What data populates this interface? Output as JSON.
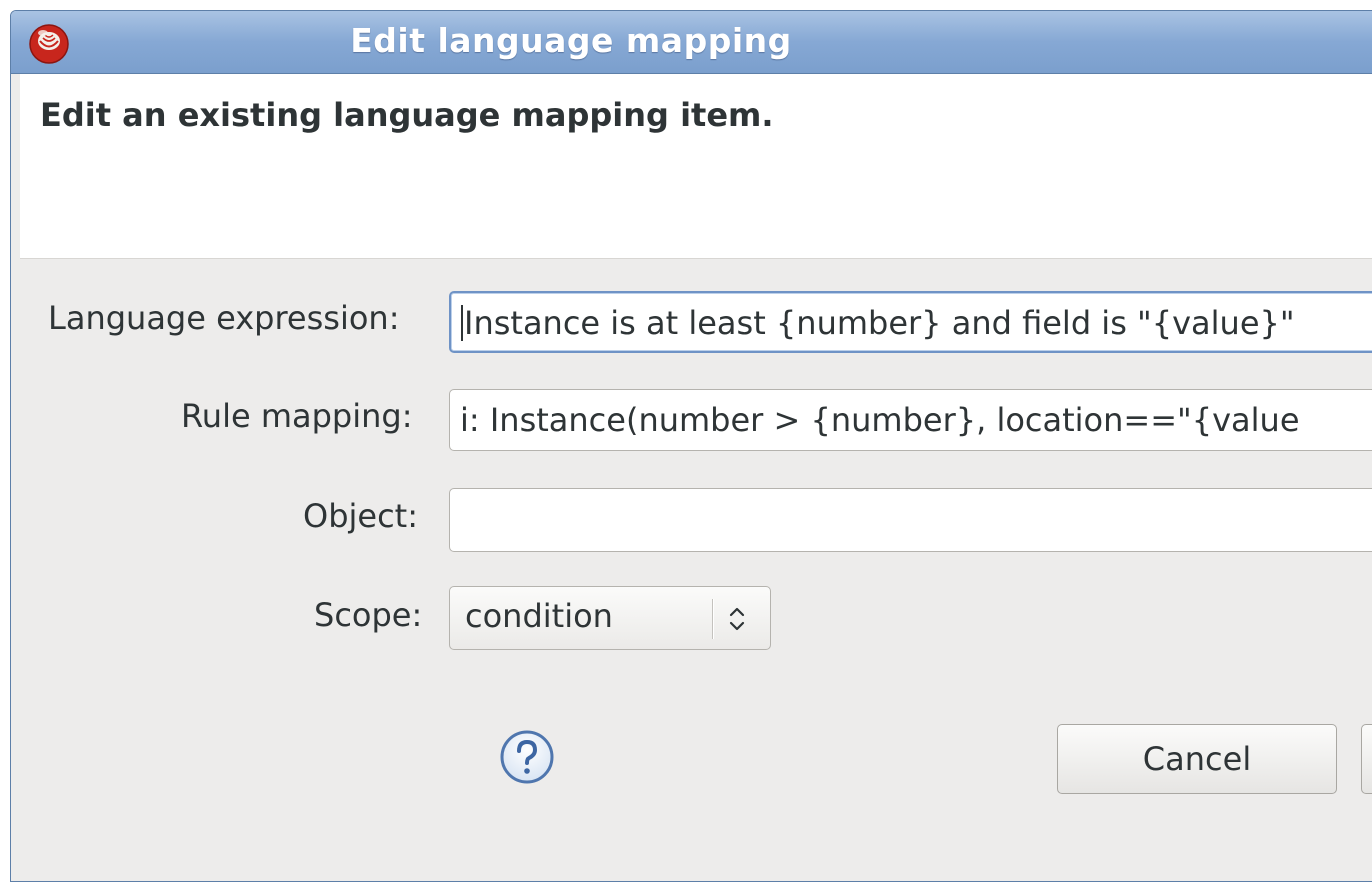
{
  "window": {
    "title": "Edit language mapping"
  },
  "header": {
    "message": "Edit an existing language mapping item."
  },
  "form": {
    "language_expression": {
      "label": "Language expression:",
      "value": "Instance is at least {number} and field is \"{value}\""
    },
    "rule_mapping": {
      "label": "Rule mapping:",
      "value": "i: Instance(number > {number}, location==\"{value"
    },
    "object": {
      "label": "Object:",
      "value": ""
    },
    "scope": {
      "label": "Scope:",
      "selected": "condition"
    }
  },
  "buttons": {
    "cancel": "Cancel",
    "ok": ""
  },
  "icons": {
    "app": "app-logo-icon",
    "help": "help-icon",
    "combo_arrows": "up-down-arrows-icon"
  }
}
